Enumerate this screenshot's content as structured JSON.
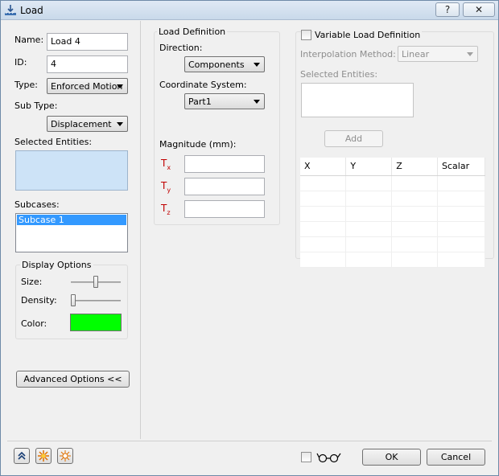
{
  "window": {
    "title": "Load",
    "help_label": "?",
    "close_label": "✕"
  },
  "left": {
    "name_label": "Name:",
    "name_value": "Load 4",
    "id_label": "ID:",
    "id_value": "4",
    "type_label": "Type:",
    "type_value": "Enforced Motion",
    "subtype_label": "Sub Type:",
    "subtype_value": "Displacement",
    "selected_entities_label": "Selected Entities:",
    "subcases_label": "Subcases:",
    "subcases": [
      "Subcase 1"
    ],
    "display_options": {
      "title": "Display Options",
      "size_label": "Size:",
      "size_level": 0.5,
      "density_label": "Density:",
      "density_level": 0.0,
      "color_label": "Color:",
      "color": "#00ff00"
    },
    "advanced_button": "Advanced Options <<"
  },
  "load_definition": {
    "title": "Load Definition",
    "direction_label": "Direction:",
    "direction_value": "Components",
    "coord_label": "Coordinate System:",
    "coord_value": "Part1",
    "magnitude_label": "Magnitude (mm):",
    "components": [
      {
        "letter": "T",
        "sub": "x",
        "value": ""
      },
      {
        "letter": "T",
        "sub": "y",
        "value": ""
      },
      {
        "letter": "T",
        "sub": "z",
        "value": ""
      }
    ]
  },
  "variable": {
    "checkbox_label": "Variable Load Definition",
    "checked": false,
    "interp_label": "Interpolation Method:",
    "interp_value": "Linear",
    "selected_label": "Selected Entities:",
    "add_button": "Add",
    "table_headers": [
      "X",
      "Y",
      "Z",
      "Scalar"
    ],
    "table_rows": [
      [
        "",
        "",
        "",
        ""
      ],
      [
        "",
        "",
        "",
        ""
      ],
      [
        "",
        "",
        "",
        ""
      ],
      [
        "",
        "",
        "",
        ""
      ],
      [
        "",
        "",
        "",
        ""
      ],
      [
        "",
        "",
        "",
        ""
      ]
    ]
  },
  "footer": {
    "icons": [
      "collapse-up-icon",
      "load-star-icon",
      "load-star-outline-icon"
    ],
    "glasses_checked": false,
    "ok_button": "OK",
    "cancel_button": "Cancel"
  },
  "colors": {
    "accent_red": "#c00000",
    "selection_blue": "#3399ff",
    "entities_box": "#cde3f7"
  }
}
